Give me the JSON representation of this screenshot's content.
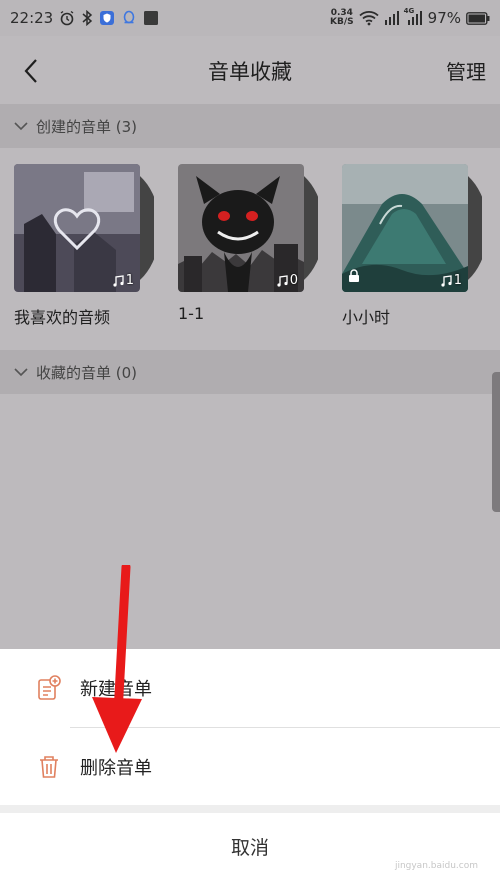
{
  "status_bar": {
    "time": "22:23",
    "speed_value": "0.34",
    "speed_unit": "KB/S",
    "signal_tag": "4G",
    "battery": "97%"
  },
  "header": {
    "title": "音单收藏",
    "manage_label": "管理",
    "back_icon": "chevron-left-icon"
  },
  "sections": {
    "created": {
      "label": "创建的音单 (3)"
    },
    "collected": {
      "label": "收藏的音单 (0)"
    }
  },
  "playlists": [
    {
      "name": "我喜欢的音频",
      "count": "1",
      "locked": false
    },
    {
      "name": "1-1",
      "count": "0",
      "locked": false
    },
    {
      "name": "小小时",
      "count": "1",
      "locked": true
    }
  ],
  "sheet": {
    "new_label": "新建音单",
    "delete_label": "删除音单",
    "cancel_label": "取消"
  },
  "watermark": "jingyan.baidu.com",
  "colors": {
    "overlay_bg": "#bdbabd",
    "section_bg": "#b0adb0",
    "sheet_bg": "#ffffff",
    "accent_icon": "#e0805f",
    "annotation_red": "#e81a1a"
  }
}
